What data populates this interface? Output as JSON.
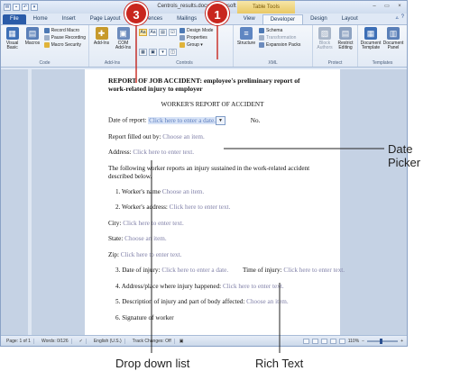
{
  "window": {
    "title": "Centrols_results.docx - Microsoft Word",
    "context_tab": "Table Tools",
    "controls": [
      "–",
      "▭",
      "×"
    ]
  },
  "tabs": [
    {
      "label": "File",
      "kind": "file"
    },
    {
      "label": "Home",
      "kind": "normal"
    },
    {
      "label": "Insert",
      "kind": "normal"
    },
    {
      "label": "Page Layout",
      "kind": "normal"
    },
    {
      "label": "References",
      "kind": "normal"
    },
    {
      "label": "Mailings",
      "kind": "normal"
    },
    {
      "label": "Review",
      "kind": "normal"
    },
    {
      "label": "View",
      "kind": "normal"
    },
    {
      "label": "Developer",
      "kind": "active"
    },
    {
      "label": "Design",
      "kind": "normal"
    },
    {
      "label": "Layout",
      "kind": "normal"
    }
  ],
  "ribbon": {
    "code": {
      "label": "Code",
      "visual_basic": "Visual Basic",
      "macros": "Macros",
      "record_macro": "Record Macro",
      "pause_recording": "Pause Recording",
      "macro_security": "Macro Security"
    },
    "addins": {
      "label": "Add-Ins",
      "addins": "Add-Ins",
      "com_addins": "COM Add-Ins"
    },
    "controls": {
      "label": "Controls",
      "design_mode": "Design Mode",
      "properties": "Properties",
      "group": "Group ▾",
      "grid": [
        "Aa",
        "Aa",
        "▤",
        "☑",
        "▦",
        "▣",
        "▾",
        "◫"
      ]
    },
    "xml": {
      "label": "XML",
      "structure": "Structure",
      "schema": "Schema",
      "transformation": "Transformation",
      "expansion_packs": "Expansion Packs"
    },
    "protect": {
      "label": "Protect",
      "block_authors": "Block Authors",
      "restrict_editing": "Restrict Editing"
    },
    "templates": {
      "label": "Templates",
      "document_template": "Document Template",
      "document_panel": "Document Panel"
    }
  },
  "document": {
    "heading": "REPORT OF JOB ACCIDENT: employee's preliminary report of work-related injury to employer",
    "subheading": "WORKER'S REPORT OF ACCIDENT",
    "date_label": "Date of report:",
    "date_placeholder": "Click here to enter a date.",
    "no_label": "No.",
    "filled_label": "Report filled out by:",
    "choose_item": "Choose an item.",
    "address_label": "Address:",
    "enter_text": "Click here to enter text.",
    "paragraph": "The following worker reports an injury sustained in the work-related accident described below.",
    "item1_label": "1.   Worker's name",
    "item2_label": "2.   Worker's address:",
    "city_label": "City:",
    "state_label": "State:",
    "zip_label": "Zip:",
    "item3_label": "3.   Date of injury:",
    "enter_date": "Click here to enter a date.",
    "time_label": "Time of injury:",
    "item4_label": "4.   Address/place where injury happened:",
    "item5_label": "5.   Description of injury and part of body affected:",
    "item6_label": "6.   Signature of worker"
  },
  "status": {
    "page": "Page: 1 of 1",
    "words": "Words: 0/126",
    "language": "English (U.S.)",
    "track": "Track Changes: Off",
    "zoom": "110%"
  },
  "callouts": {
    "step3": "3",
    "step1": "1",
    "date_picker": "Date Picker",
    "drop_down_list": "Drop down list",
    "rich_text": "Rich Text"
  },
  "colors": {
    "callout": "#c8261e",
    "file_tab": "#2a5ba8"
  }
}
